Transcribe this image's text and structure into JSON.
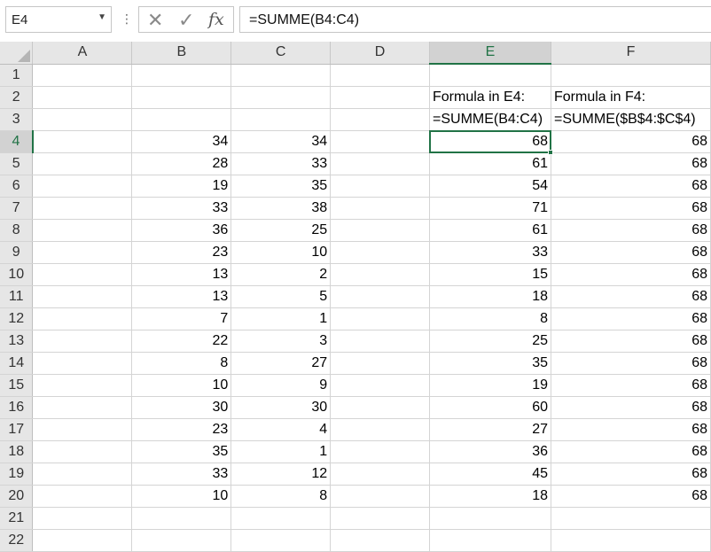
{
  "formula_bar": {
    "name_box": "E4",
    "formula": "=SUMME(B4:C4)"
  },
  "columns": [
    "A",
    "B",
    "C",
    "D",
    "E",
    "F"
  ],
  "active_cell": {
    "col": "E",
    "row": "4"
  },
  "rows": [
    {
      "n": "1",
      "A": "",
      "B": "",
      "C": "",
      "D": "",
      "E": "",
      "F": ""
    },
    {
      "n": "2",
      "A": "",
      "B": "",
      "C": "",
      "D": "",
      "E": "Formula in E4:",
      "F": "Formula in F4:"
    },
    {
      "n": "3",
      "A": "",
      "B": "",
      "C": "",
      "D": "",
      "E": "=SUMME(B4:C4)",
      "F": "=SUMME($B$4:$C$4)"
    },
    {
      "n": "4",
      "A": "",
      "B": "34",
      "C": "34",
      "D": "",
      "E": "68",
      "F": "68"
    },
    {
      "n": "5",
      "A": "",
      "B": "28",
      "C": "33",
      "D": "",
      "E": "61",
      "F": "68"
    },
    {
      "n": "6",
      "A": "",
      "B": "19",
      "C": "35",
      "D": "",
      "E": "54",
      "F": "68"
    },
    {
      "n": "7",
      "A": "",
      "B": "33",
      "C": "38",
      "D": "",
      "E": "71",
      "F": "68"
    },
    {
      "n": "8",
      "A": "",
      "B": "36",
      "C": "25",
      "D": "",
      "E": "61",
      "F": "68"
    },
    {
      "n": "9",
      "A": "",
      "B": "23",
      "C": "10",
      "D": "",
      "E": "33",
      "F": "68"
    },
    {
      "n": "10",
      "A": "",
      "B": "13",
      "C": "2",
      "D": "",
      "E": "15",
      "F": "68"
    },
    {
      "n": "11",
      "A": "",
      "B": "13",
      "C": "5",
      "D": "",
      "E": "18",
      "F": "68"
    },
    {
      "n": "12",
      "A": "",
      "B": "7",
      "C": "1",
      "D": "",
      "E": "8",
      "F": "68"
    },
    {
      "n": "13",
      "A": "",
      "B": "22",
      "C": "3",
      "D": "",
      "E": "25",
      "F": "68"
    },
    {
      "n": "14",
      "A": "",
      "B": "8",
      "C": "27",
      "D": "",
      "E": "35",
      "F": "68"
    },
    {
      "n": "15",
      "A": "",
      "B": "10",
      "C": "9",
      "D": "",
      "E": "19",
      "F": "68"
    },
    {
      "n": "16",
      "A": "",
      "B": "30",
      "C": "30",
      "D": "",
      "E": "60",
      "F": "68"
    },
    {
      "n": "17",
      "A": "",
      "B": "23",
      "C": "4",
      "D": "",
      "E": "27",
      "F": "68"
    },
    {
      "n": "18",
      "A": "",
      "B": "35",
      "C": "1",
      "D": "",
      "E": "36",
      "F": "68"
    },
    {
      "n": "19",
      "A": "",
      "B": "33",
      "C": "12",
      "D": "",
      "E": "45",
      "F": "68"
    },
    {
      "n": "20",
      "A": "",
      "B": "10",
      "C": "8",
      "D": "",
      "E": "18",
      "F": "68"
    },
    {
      "n": "21",
      "A": "",
      "B": "",
      "C": "",
      "D": "",
      "E": "",
      "F": ""
    },
    {
      "n": "22",
      "A": "",
      "B": "",
      "C": "",
      "D": "",
      "E": "",
      "F": ""
    }
  ],
  "icons": {
    "cancel": "x-icon",
    "enter": "check-icon",
    "insert_function": "fx-icon",
    "name_box_dropdown": "chevron-down-icon",
    "more": "vertical-dots-icon"
  },
  "colors": {
    "accent": "#217346",
    "header_bg": "#e6e6e6",
    "gridline": "#d4d4d4"
  }
}
